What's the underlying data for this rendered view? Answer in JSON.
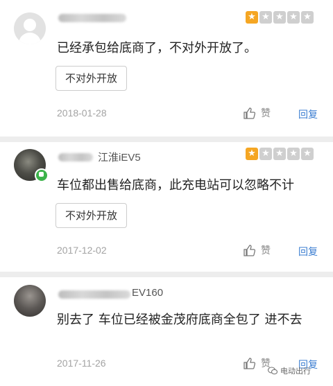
{
  "reviews": [
    {
      "car": "",
      "stars_filled": 1,
      "stars_total": 5,
      "text": "已经承包给底商了，不对外开放了。",
      "tag": "不对外开放",
      "date": "2018-01-28",
      "like_label": "赞",
      "reply_label": "回复"
    },
    {
      "car": "江淮iEV5",
      "stars_filled": 1,
      "stars_total": 5,
      "text": "车位都出售给底商，此充电站可以忽略不计",
      "tag": "不对外开放",
      "date": "2017-12-02",
      "like_label": "赞",
      "reply_label": "回复"
    },
    {
      "car": "EV160",
      "text": "别去了  车位已经被金茂府底商全包了 进不去",
      "date": "2017-11-26",
      "like_label": "赞",
      "reply_label": "回复"
    }
  ],
  "watermark": {
    "text": "电动出行"
  },
  "colors": {
    "star_on": "#f5a623",
    "star_off": "#cfcfcf",
    "reply": "#3b7ed1"
  }
}
